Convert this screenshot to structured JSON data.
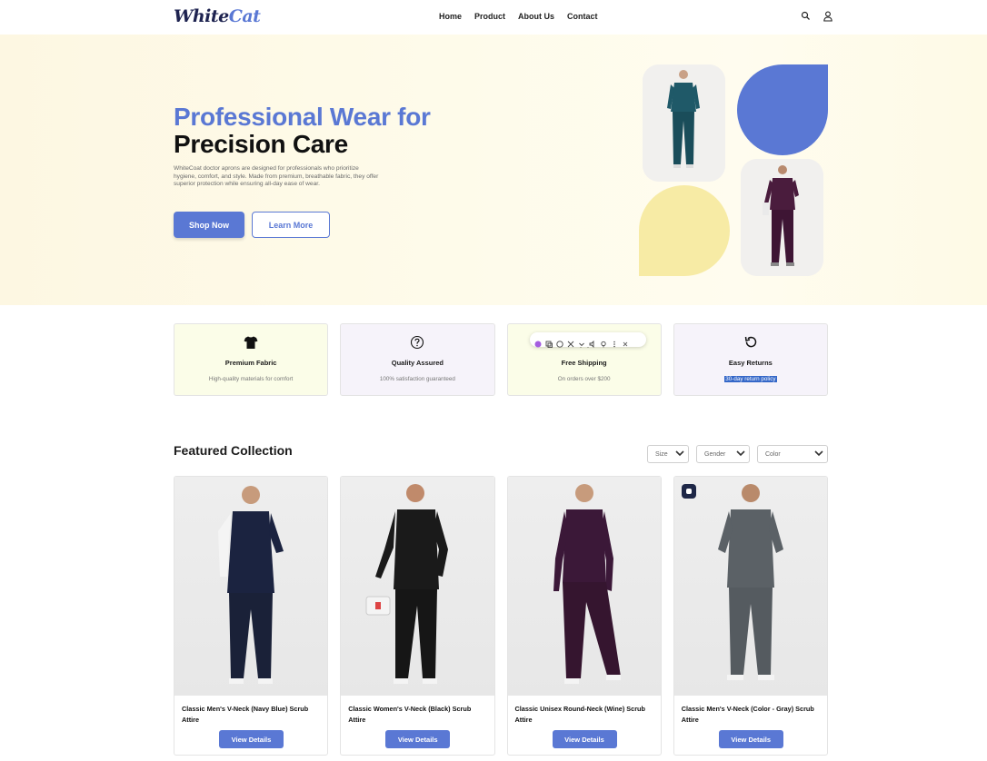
{
  "brand": {
    "part1": "White",
    "part2": "Cat"
  },
  "nav": {
    "items": [
      "Home",
      "Product",
      "About Us",
      "Contact"
    ],
    "icons": [
      "search-icon",
      "user-icon"
    ]
  },
  "hero": {
    "title_line1": "Professional Wear for",
    "title_line2": "Precision Care",
    "description": "WhiteCoat doctor aprons are designed for professionals who prioritize hygiene, comfort, and style. Made from premium, breathable fabric, they offer superior protection while ensuring all-day ease of wear.",
    "primary_button": "Shop Now",
    "secondary_button": "Learn More"
  },
  "features": [
    {
      "icon": "tshirt-icon",
      "title": "Premium Fabric",
      "subtitle": "High-quality materials for comfort"
    },
    {
      "icon": "question-circle-icon",
      "title": "Quality Assured",
      "subtitle": "100% satisfaction guaranteed"
    },
    {
      "icon": "truck-icon",
      "title": "Free Shipping",
      "subtitle": "On orders over $200"
    },
    {
      "icon": "return-icon",
      "title": "Easy Returns",
      "subtitle": "30-day return policy"
    }
  ],
  "collection": {
    "title": "Featured Collection",
    "filters": [
      "Size",
      "Gender",
      "Color"
    ],
    "products": [
      {
        "name": "Classic Men's V-Neck (Navy Blue) Scrub Attire",
        "button": "View Details",
        "color": "#1b2340"
      },
      {
        "name": "Classic Women's V-Neck (Black) Scrub Attire",
        "button": "View Details",
        "color": "#1a1a1a"
      },
      {
        "name": "Classic Unisex Round-Neck (Wine) Scrub Attire",
        "button": "View Details",
        "color": "#3b1838"
      },
      {
        "name": "Classic Men's V-Neck (Color - Gray) Scrub Attire",
        "button": "View Details",
        "color": "#5b6166"
      }
    ]
  },
  "colors": {
    "accent": "#5a78d4",
    "brand_dark": "#1e2350",
    "blob_yellow": "#f7eba5"
  }
}
